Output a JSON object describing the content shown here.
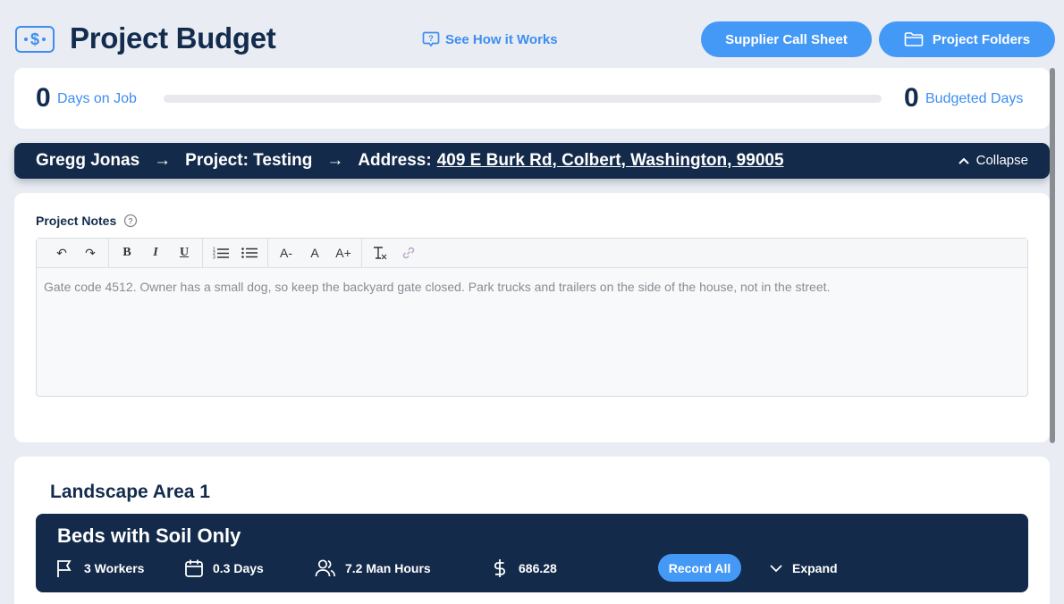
{
  "header": {
    "title": "Project Budget",
    "how_link": "See How it Works",
    "supplier_button": "Supplier Call Sheet",
    "folders_button": "Project Folders"
  },
  "days": {
    "on_job_value": "0",
    "on_job_label": "Days on Job",
    "budgeted_value": "0",
    "budgeted_label": "Budgeted Days",
    "progress_fraction": 0
  },
  "breadcrumb": {
    "client": "Gregg Jonas",
    "arrow": "→",
    "project": "Project: Testing",
    "address_label": "Address:",
    "address": "409 E Burk Rd, Colbert, Washington, 99005",
    "collapse": "Collapse"
  },
  "notes": {
    "label": "Project Notes",
    "toolbar": {
      "undo": "↶",
      "redo": "↷",
      "bold": "B",
      "italic": "I",
      "underline": "U",
      "font_smaller": "A-",
      "font_normal": "A",
      "font_larger": "A+"
    },
    "text": "Gate code 4512. Owner has a small dog, so keep the backyard gate closed. Park trucks and trailers on the side of the house, not in the street."
  },
  "area": {
    "title": "Landscape Area 1",
    "task": {
      "title": "Beds with Soil Only",
      "workers": "3 Workers",
      "days": "0.3 Days",
      "man_hours": "7.2 Man Hours",
      "cost": "686.28",
      "record_all": "Record All",
      "expand": "Expand"
    }
  },
  "colors": {
    "accent": "#3d8ef0",
    "button": "#4499f6",
    "navy": "#132a4a",
    "background": "#e9ecf2"
  }
}
